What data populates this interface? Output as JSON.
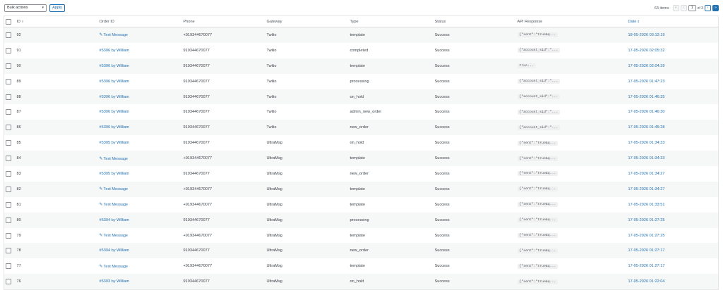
{
  "toolbar": {
    "bulk_actions": "Bulk actions",
    "apply": "Apply",
    "items_count": "63 items",
    "first": "«",
    "prev": "‹",
    "current_page": "1",
    "of_pages": "of 3",
    "next": "›",
    "last": "»"
  },
  "columns": {
    "id": "ID",
    "order_id": "Order ID",
    "phone": "Phone",
    "gateway": "Gateway",
    "type": "Type",
    "status": "Status",
    "api_response": "API Response",
    "date": "Date"
  },
  "rows": [
    {
      "id": "92",
      "order": "Test Message",
      "order_icon": "pencil-icon",
      "phone": "+919344670077",
      "gateway": "Twilio",
      "type": "template",
      "status": "Success",
      "response": "{\"sent\":\"true&q...",
      "date": "18-05-2026 03:12:19"
    },
    {
      "id": "91",
      "order": "#5306 by William",
      "phone": "919344670077",
      "gateway": "Twilio",
      "type": "completed",
      "status": "Success",
      "response": "{\"account_sid\":\"...",
      "date": "17-05-2026 02:05:32"
    },
    {
      "id": "90",
      "order": "#5306 by William",
      "phone": "919344670077",
      "gateway": "Twilio",
      "type": "template",
      "status": "Success",
      "response": "true...",
      "date": "17-05-2026 02:04:39"
    },
    {
      "id": "89",
      "order": "#5306 by William",
      "phone": "919344670077",
      "gateway": "Twilio",
      "type": "processing",
      "status": "Success",
      "response": "{\"account_sid\":\"...",
      "date": "17-05-2026 01:47:23"
    },
    {
      "id": "88",
      "order": "#5306 by William",
      "phone": "919344670077",
      "gateway": "Twilio",
      "type": "on_hold",
      "status": "Success",
      "response": "{\"account_sid\":\"...",
      "date": "17-05-2026 01:46:35"
    },
    {
      "id": "87",
      "order": "#5306 by William",
      "phone": "919344670077",
      "gateway": "Twilio",
      "type": "admin_new_order",
      "status": "Success",
      "response": "{\"account_sid\":\"...",
      "date": "17-05-2026 01:46:30"
    },
    {
      "id": "86",
      "order": "#5306 by William",
      "phone": "919344670077",
      "gateway": "Twilio",
      "type": "new_order",
      "status": "Success",
      "response": "{\"account_sid\":\"...",
      "date": "17-05-2026 01:45:28"
    },
    {
      "id": "85",
      "order": "#5305 by William",
      "phone": "919344670077",
      "gateway": "UltraMsg",
      "type": "on_hold",
      "status": "Success",
      "response": "{\"sent\":\"true&q...",
      "date": "17-05-2026 01:34:33"
    },
    {
      "id": "84",
      "order": "Test Message",
      "order_icon": "pencil-icon",
      "phone": "+919344670077",
      "gateway": "UltraMsg",
      "type": "template",
      "status": "Success",
      "response": "{\"sent\":\"true&q...",
      "date": "17-05-2026 01:34:33"
    },
    {
      "id": "83",
      "order": "#5305 by William",
      "phone": "919344670077",
      "gateway": "UltraMsg",
      "type": "new_order",
      "status": "Success",
      "response": "{\"sent\":\"true&q...",
      "date": "17-05-2026 01:34:27"
    },
    {
      "id": "82",
      "order": "Test Message",
      "order_icon": "pencil-icon",
      "phone": "+919344670077",
      "gateway": "UltraMsg",
      "type": "template",
      "status": "Success",
      "response": "{\"sent\":\"true&q...",
      "date": "17-05-2026 01:34:27"
    },
    {
      "id": "81",
      "order": "Test Message",
      "order_icon": "pencil-icon",
      "phone": "+919344670077",
      "gateway": "UltraMsg",
      "type": "template",
      "status": "Success",
      "response": "{\"sent\":\"true&q...",
      "date": "17-05-2026 01:33:51"
    },
    {
      "id": "80",
      "order": "#5304 by William",
      "phone": "919344670077",
      "gateway": "UltraMsg",
      "type": "processing",
      "status": "Success",
      "response": "{\"sent\":\"true&q...",
      "date": "17-05-2026 01:27:25"
    },
    {
      "id": "79",
      "order": "Test Message",
      "order_icon": "pencil-icon",
      "phone": "+919344670077",
      "gateway": "UltraMsg",
      "type": "template",
      "status": "Success",
      "response": "{\"sent\":\"true&q...",
      "date": "17-05-2026 01:27:25"
    },
    {
      "id": "78",
      "order": "#5304 by William",
      "phone": "919344670077",
      "gateway": "UltraMsg",
      "type": "new_order",
      "status": "Success",
      "response": "{\"sent\":\"true&q...",
      "date": "17-05-2026 01:27:17"
    },
    {
      "id": "77",
      "order": "Test Message",
      "order_icon": "pencil-icon",
      "phone": "+919344670077",
      "gateway": "UltraMsg",
      "type": "template",
      "status": "Success",
      "response": "{\"sent\":\"true&q...",
      "date": "17-05-2026 01:27:17"
    },
    {
      "id": "76",
      "order": "#5303 by William",
      "phone": "919344670077",
      "gateway": "UltraMsg",
      "type": "on_hold",
      "status": "Success",
      "response": "{\"sent\":\"true&q...",
      "date": "17-05-2026 01:22:04"
    }
  ]
}
